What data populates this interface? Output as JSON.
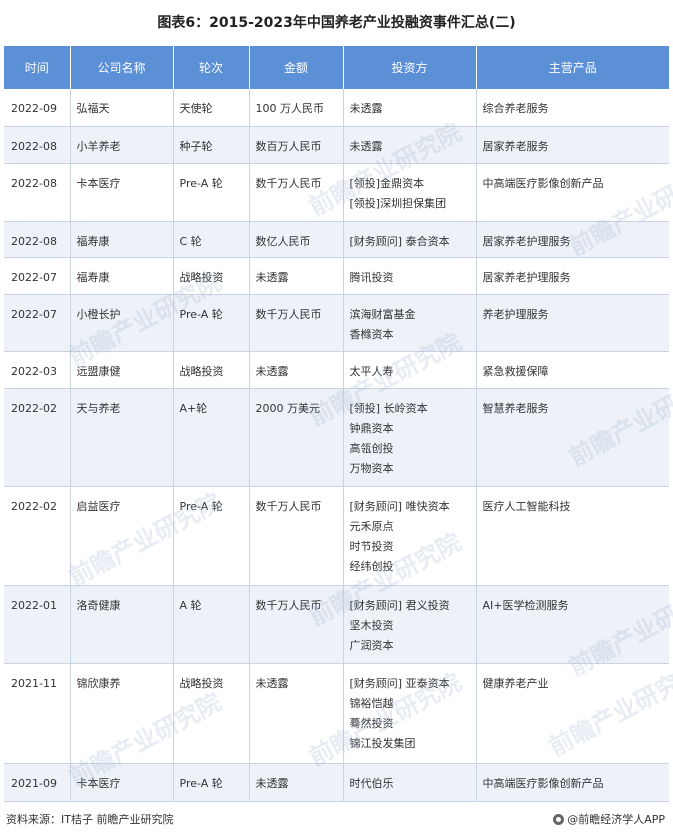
{
  "title": "图表6：2015-2023年中国养老产业投融资事件汇总(二)",
  "table": {
    "headers": [
      "时间",
      "公司名称",
      "轮次",
      "金额",
      "投资方",
      "主营产品"
    ],
    "rows": [
      {
        "date": "2022-09",
        "company": "弘福天",
        "round": "天使轮",
        "amount": "100 万人民币",
        "investors": [
          "未透露"
        ],
        "product": "综合养老服务"
      },
      {
        "date": "2022-08",
        "company": "小羊养老",
        "round": "种子轮",
        "amount": "数百万人民币",
        "investors": [
          "未透露"
        ],
        "product": "居家养老服务"
      },
      {
        "date": "2022-08",
        "company": "卡本医疗",
        "round": "Pre-A 轮",
        "amount": "数千万人民币",
        "investors": [
          "[领投]金鼎资本",
          "[领投]深圳担保集团"
        ],
        "product": "中高端医疗影像创新产品"
      },
      {
        "date": "2022-08",
        "company": "福寿康",
        "round": "C 轮",
        "amount": "数亿人民币",
        "investors": [
          "[财务顾问] 泰合资本"
        ],
        "product": "居家养老护理服务"
      },
      {
        "date": "2022-07",
        "company": "福寿康",
        "round": "战略投资",
        "amount": "未透露",
        "investors": [
          "腾讯投资"
        ],
        "product": "居家养老护理服务"
      },
      {
        "date": "2022-07",
        "company": "小橙长护",
        "round": "Pre-A 轮",
        "amount": "数千万人民币",
        "investors": [
          "滨海财富基金",
          "香橼资本"
        ],
        "product": "养老护理服务"
      },
      {
        "date": "2022-03",
        "company": "远盟康健",
        "round": "战略投资",
        "amount": "未透露",
        "investors": [
          "太平人寿"
        ],
        "product": "紧急救援保障"
      },
      {
        "date": "2022-02",
        "company": "天与养老",
        "round": "A+轮",
        "amount": "2000 万美元",
        "investors": [
          "[领投] 长岭资本",
          "钟鼎资本",
          "高瓴创投",
          "万物资本"
        ],
        "product": "智慧养老服务"
      },
      {
        "date": "2022-02",
        "company": "启益医疗",
        "round": "Pre-A 轮",
        "amount": "数千万人民币",
        "investors": [
          "[财务顾问] 唯快资本",
          "元禾原点",
          "时节投资",
          "经纬创投"
        ],
        "product": "医疗人工智能科技"
      },
      {
        "date": "2022-01",
        "company": "洛奇健康",
        "round": "A 轮",
        "amount": "数千万人民币",
        "investors": [
          "[财务顾问] 君义投资",
          "坚木投资",
          "广润资本"
        ],
        "product": "AI+医学检测服务"
      },
      {
        "date": "2021-11",
        "company": "锦欣康养",
        "round": "战略投资",
        "amount": "未透露",
        "investors": [
          "[财务顾问] 亚泰资本",
          "锦裕恺越",
          "蓦然投资",
          "锦江投发集团"
        ],
        "product": "健康养老产业"
      },
      {
        "date": "2021-09",
        "company": "卡本医疗",
        "round": "Pre-A 轮",
        "amount": "未透露",
        "investors": [
          "时代伯乐"
        ],
        "product": "中高端医疗影像创新产品"
      }
    ]
  },
  "watermark_text": "前瞻产业研究院",
  "footer": {
    "source": "资料来源：IT桔子 前瞻产业研究院",
    "brand": "@前瞻经济学人APP"
  },
  "colors": {
    "header_bg": "#5b8fd6",
    "row_shade": "#eef2f8",
    "grid": "#c8d4e4"
  }
}
